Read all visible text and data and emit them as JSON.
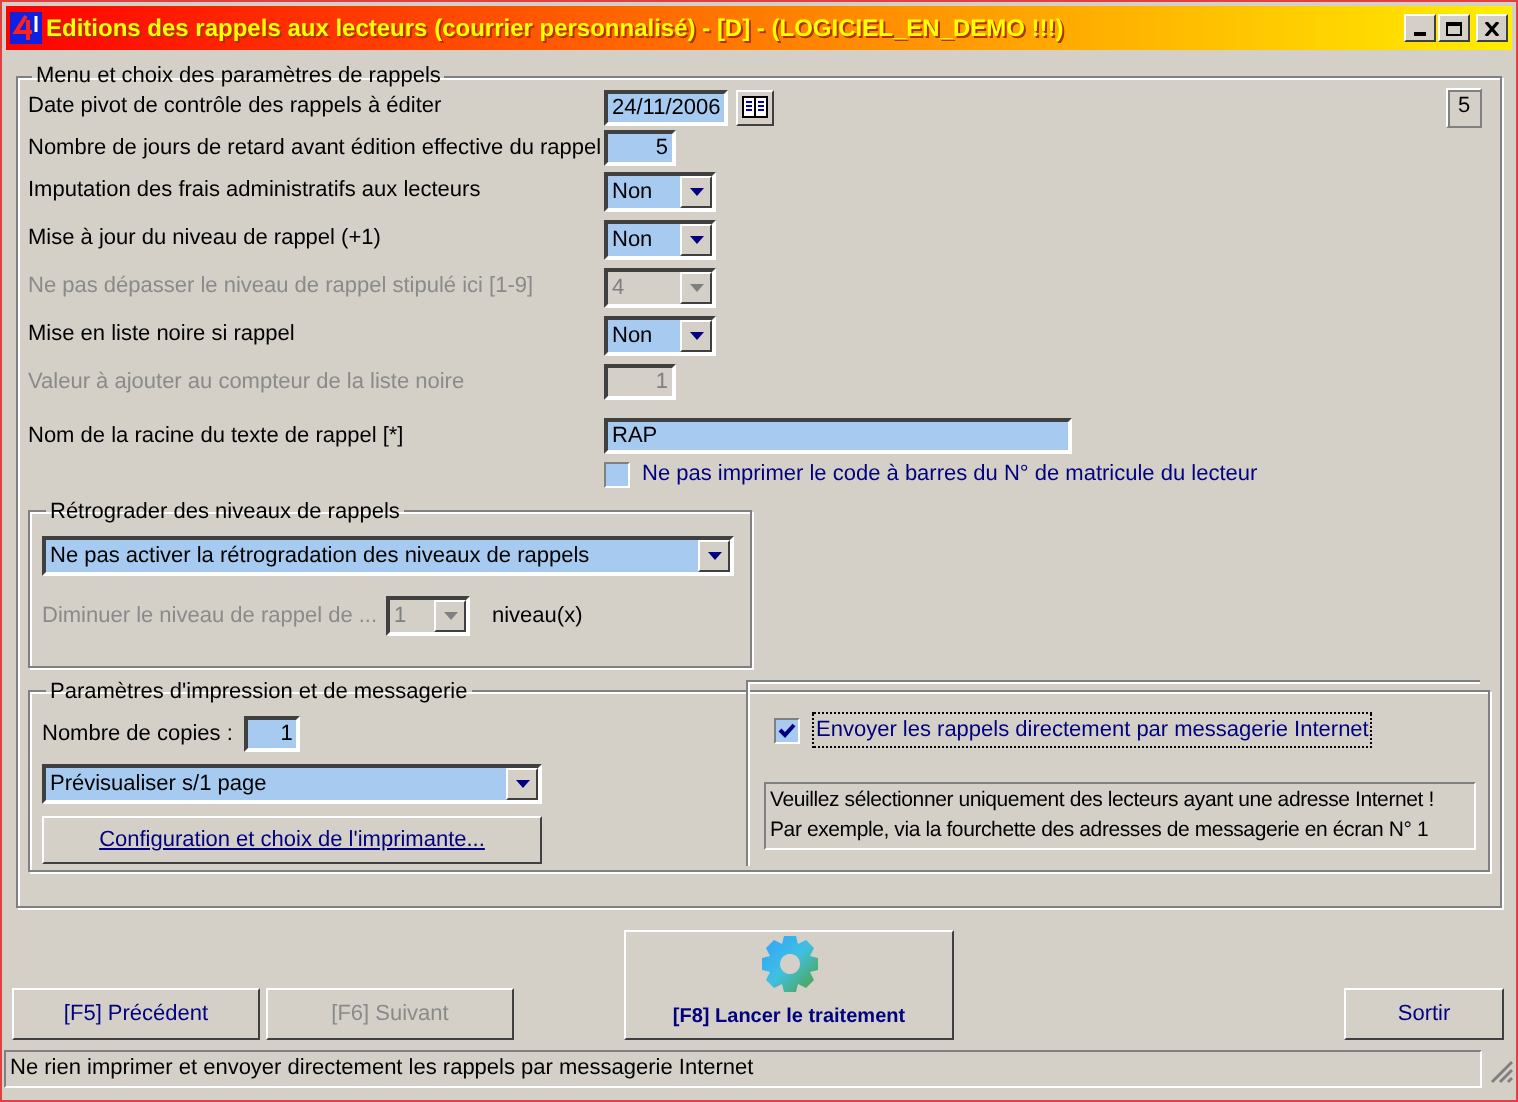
{
  "window": {
    "title": "Editions des rappels aux lecteurs (courrier personnalisé) - [D] - (LOGICIEL_EN_DEMO !!!)"
  },
  "main_group": {
    "title": "Menu et choix des paramètres de rappels",
    "page_number": "5",
    "rows": [
      {
        "kind": "date",
        "label": "Date pivot de contrôle des rappels à éditer",
        "value": "24/11/2006",
        "disabled": false
      },
      {
        "kind": "number",
        "label": "Nombre de jours de retard avant édition effective du rappel",
        "value": "5",
        "disabled": false
      },
      {
        "kind": "select",
        "label": "Imputation des frais administratifs aux lecteurs",
        "value": "Non",
        "disabled": false
      },
      {
        "kind": "select",
        "label": "Mise à jour du niveau de rappel (+1)",
        "value": "Non",
        "disabled": false
      },
      {
        "kind": "select",
        "label": "Ne pas dépasser le niveau de rappel stipulé ici [1-9]",
        "value": "4",
        "disabled": true
      },
      {
        "kind": "select",
        "label": "Mise en liste noire si rappel",
        "value": "Non",
        "disabled": false
      },
      {
        "kind": "number",
        "label": "Valeur à ajouter au compteur de la liste noire",
        "value": "1",
        "disabled": true
      },
      {
        "kind": "text",
        "label": "Nom de la racine du texte de rappel [*]",
        "value": "RAP",
        "disabled": false
      }
    ],
    "barcode_option": {
      "label": "Ne pas imprimer le code à barres du N° de matricule du lecteur",
      "checked": false
    }
  },
  "downgrade_group": {
    "title": "Rétrograder des niveaux de rappels",
    "mode": "Ne pas activer la rétrogradation des niveaux de rappels",
    "decrease": {
      "label": "Diminuer le niveau de rappel de ...",
      "value": "1",
      "disabled": true,
      "unit": "niveau(x)"
    }
  },
  "print_group": {
    "title": "Paramètres d'impression et de messagerie",
    "copies_label": "Nombre de copies :",
    "copies": "1",
    "output": "Prévisualiser s/1 page",
    "printer_button": "Configuration et choix de l'imprimante...",
    "email_option": {
      "label": "Envoyer les rappels directement par messagerie Internet",
      "checked": true
    },
    "notice": [
      "Veuillez sélectionner uniquement des lecteurs ayant une adresse Internet !",
      "Par exemple, via la fourchette des adresses de messagerie en écran N° 1"
    ]
  },
  "nav_buttons": [
    {
      "label": "[F5] Précédent",
      "disabled": false
    },
    {
      "label": "[F6] Suivant",
      "disabled": true
    }
  ],
  "run_button": {
    "label": "[F8] Lancer le traitement"
  },
  "exit_button": {
    "label": "Sortir"
  },
  "status_bar": {
    "text": "Ne rien imprimer et envoyer directement les rappels par messagerie Internet"
  }
}
